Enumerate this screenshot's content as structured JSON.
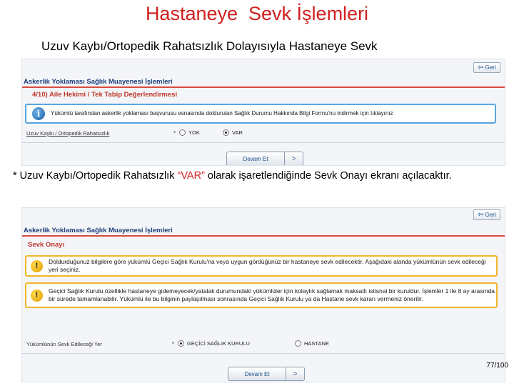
{
  "slide": {
    "title": "Hastaneye  Sevk İşlemleri",
    "subtitle": "Uzuv Kaybı/Ortopedik Rahatsızlık Dolayısıyla Hastaneye Sevk",
    "note_prefix": "* Uzuv Kaybı/Ortopedik Rahatsızlık ",
    "note_highlight": "“VAR”",
    "note_suffix": " olarak işaretlendiğinde Sevk Onayı ekranı açılacaktır.",
    "page_number": "77/100"
  },
  "panel1": {
    "back_label": "Geri",
    "header": "Askerlik Yoklaması Sağlık Muayenesi İşlemleri",
    "step": "4/10) Aile Hekimi / Tek Tabip Değerlendirmesi",
    "info_text": "Yükümlü tarafından askerlik yoklaması başvurusu esnasında doldurulan Sağlık Durumu Hakkında Bilgi Formu'nu indirmek için tıklayınız",
    "field_label": "Uzuv Kaybı / Ortopedik Rahatsızlık",
    "required_mark": "*",
    "option_no": "YOK",
    "option_yes": "VAR",
    "next_label": "Devam Et",
    "next_chevron": ">"
  },
  "panel2": {
    "back_label": "Geri",
    "header": "Askerlik Yoklaması Sağlık Muayenesi İşlemleri",
    "section": "Sevk Onayı",
    "warning_1": "Doldurduğunuz bilgilere göre yükümlü Geçici Sağlık Kurulu'na veya uygun gördüğünüz bir hastaneye sevk edilecektir. Aşağıdaki alanda yükümlünün sevk edileceği yeri seçiniz.",
    "warning_2": "Geçici Sağlık Kurulu özellikle hastaneye gidemeyecek/yatalak durumundaki yükümlüler için kolaylık sağlamak maksatlı istisnai bir kuruldur. İşlemler 1 ile 8 ay arasında bir sürede tamamlanabilir. Yükümlü ile bu bilginin paylaşılması sonrasında Geçici Sağlık Kurulu ya da Hastane sevk kararı vermeniz önerilir.",
    "field_label": "Yükümlünün Sevk Edileceği Yer",
    "required_mark": "*",
    "option_1": "GEÇİCİ SAĞLIK KURULU",
    "option_2": "HASTANE",
    "next_label": "Devam Et",
    "next_chevron": ">"
  }
}
